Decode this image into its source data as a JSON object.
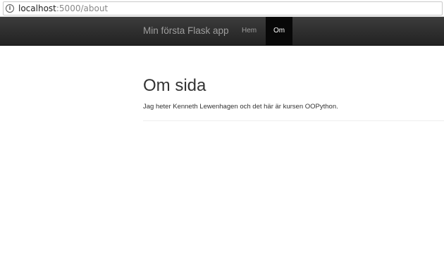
{
  "browser": {
    "url_host": "localhost",
    "url_rest": ":5000/about",
    "info_icon": "ⓘ"
  },
  "navbar": {
    "brand": "Min första Flask app",
    "items": [
      {
        "label": "Hem",
        "active": false
      },
      {
        "label": "Om",
        "active": true
      }
    ]
  },
  "main": {
    "title": "Om sida",
    "text": "Jag heter Kenneth Lewenhagen och det här är kursen OOPython."
  }
}
